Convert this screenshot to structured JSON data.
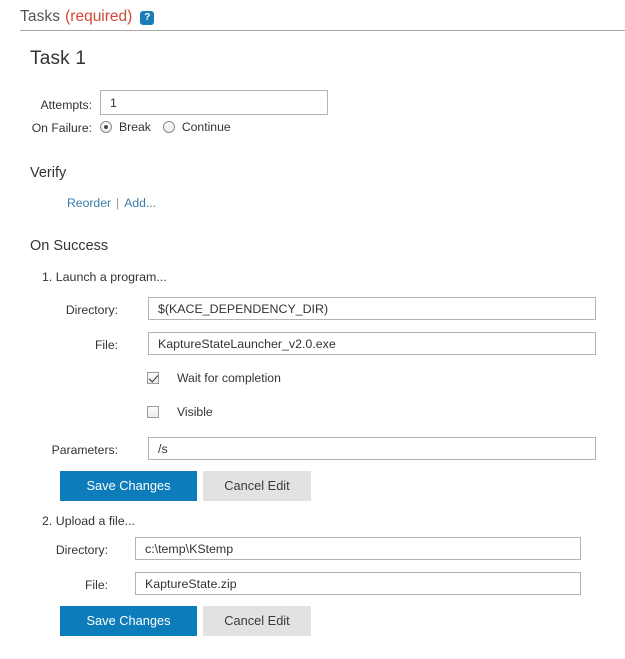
{
  "section": {
    "title": "Tasks",
    "required_note": "(required)",
    "help_icon": "help-question-icon",
    "help_glyph": "?"
  },
  "task": {
    "heading": "Task 1",
    "attempts": {
      "label": "Attempts:",
      "value": "1",
      "placeholder": ""
    },
    "on_failure": {
      "label": "On Failure:",
      "options": [
        {
          "label": "Break",
          "selected": true
        },
        {
          "label": "Continue",
          "selected": false
        }
      ]
    }
  },
  "verify": {
    "heading": "Verify",
    "links": [
      {
        "label": "Reorder"
      },
      {
        "label": "Add..."
      }
    ],
    "separator": "|"
  },
  "on_success": {
    "heading": "On Success",
    "steps": [
      {
        "index": "1.",
        "label": "1. Launch a program...",
        "fields": [
          {
            "label": "Directory:",
            "value": "$(KACE_DEPENDENCY_DIR)"
          },
          {
            "label": "File:",
            "value": "KaptureStateLauncher_v2.0.exe"
          },
          {
            "label": "Parameters:",
            "value": "/s"
          }
        ],
        "checkboxes": [
          {
            "label": "Wait for completion",
            "checked": true
          },
          {
            "label": "Visible",
            "checked": false
          }
        ],
        "buttons": {
          "save": "Save Changes",
          "cancel": "Cancel Edit"
        }
      },
      {
        "index": "2.",
        "label": "2. Upload a file...",
        "fields": [
          {
            "label": "Directory:",
            "value": "c:\\temp\\KStemp"
          },
          {
            "label": "File:",
            "value": "KaptureState.zip"
          }
        ],
        "buttons": {
          "save": "Save Changes",
          "cancel": "Cancel Edit"
        }
      }
    ]
  },
  "colors": {
    "accent_blue": "#0d7cba",
    "required_red": "#d14836",
    "link_blue": "#3b7ca8",
    "help_badge": "#1a7db6",
    "rule_gray": "#a8a8a8",
    "button_gray": "#e2e2e2"
  }
}
